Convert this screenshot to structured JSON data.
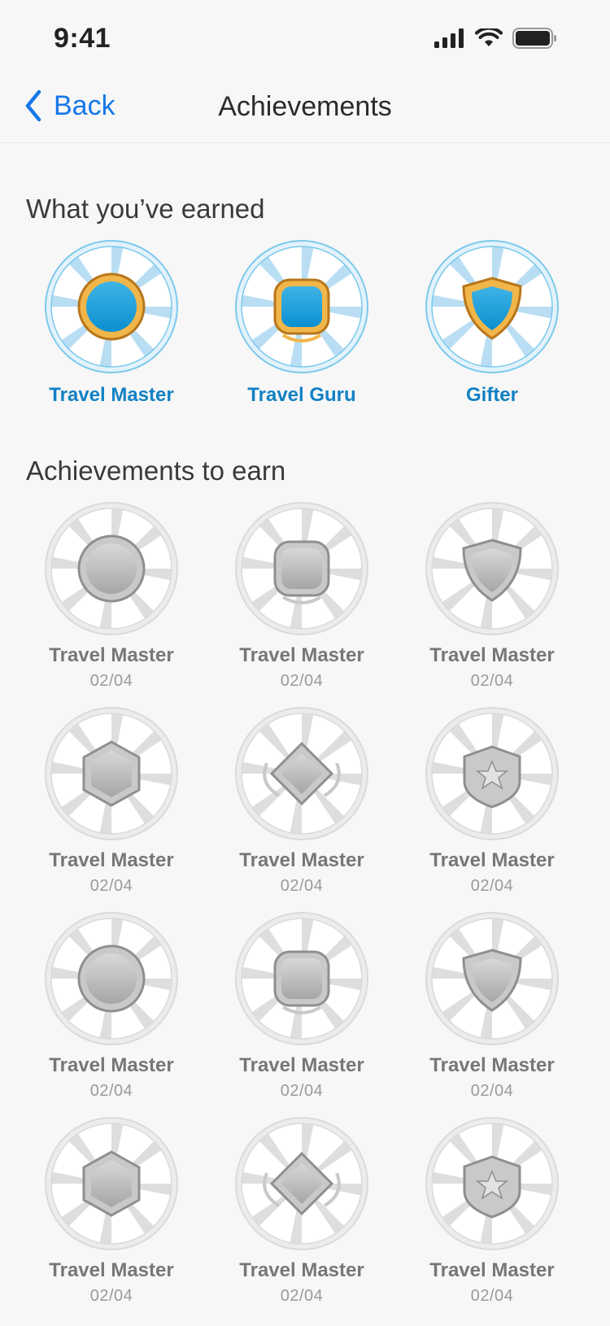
{
  "status_bar": {
    "time": "9:41",
    "signal_icon": "cellular-signal-icon",
    "wifi_icon": "wifi-icon",
    "battery_icon": "battery-icon"
  },
  "nav": {
    "back_label": "Back",
    "back_icon": "chevron-left-icon",
    "title": "Achievements"
  },
  "earned_section": {
    "title": "What you’ve earned",
    "badges": [
      {
        "name": "Travel Master",
        "icon": "round-medal-badge-icon"
      },
      {
        "name": "Travel Guru",
        "icon": "laurel-badge-icon"
      },
      {
        "name": "Gifter",
        "icon": "shield-badge-icon"
      }
    ]
  },
  "to_earn_section": {
    "title": "Achievements to earn",
    "badges": [
      {
        "name": "Travel Master",
        "progress": "02/04",
        "icon": "pentagon-badge-icon"
      },
      {
        "name": "Travel Master",
        "progress": "02/04",
        "icon": "winged-shield-badge-icon"
      },
      {
        "name": "Travel Master",
        "progress": "02/04",
        "icon": "square-frame-badge-icon"
      },
      {
        "name": "Travel Master",
        "progress": "02/04",
        "icon": "hexagon-badge-icon"
      },
      {
        "name": "Travel Master",
        "progress": "02/04",
        "icon": "diamond-wings-badge-icon"
      },
      {
        "name": "Travel Master",
        "progress": "02/04",
        "icon": "laurel-badge-icon"
      },
      {
        "name": "Travel Master",
        "progress": "02/04",
        "icon": "ribbon-circle-badge-icon"
      },
      {
        "name": "Travel Master",
        "progress": "02/04",
        "icon": "star-shield-badge-icon"
      },
      {
        "name": "Travel Master",
        "progress": "02/04",
        "icon": "medal-ribbon-badge-icon"
      },
      {
        "name": "Travel Master",
        "progress": "02/04",
        "icon": "horned-hexagon-badge-icon"
      },
      {
        "name": "Travel Master",
        "progress": "02/04",
        "icon": "leaf-shield-badge-icon"
      },
      {
        "name": "Travel Master",
        "progress": "02/04",
        "icon": "laurel-star-shield-badge-icon"
      }
    ]
  },
  "colors": {
    "accent": "#1677e8",
    "earned_label": "#1281c4",
    "locked_label": "#777777",
    "background": "#f7f7f7"
  }
}
